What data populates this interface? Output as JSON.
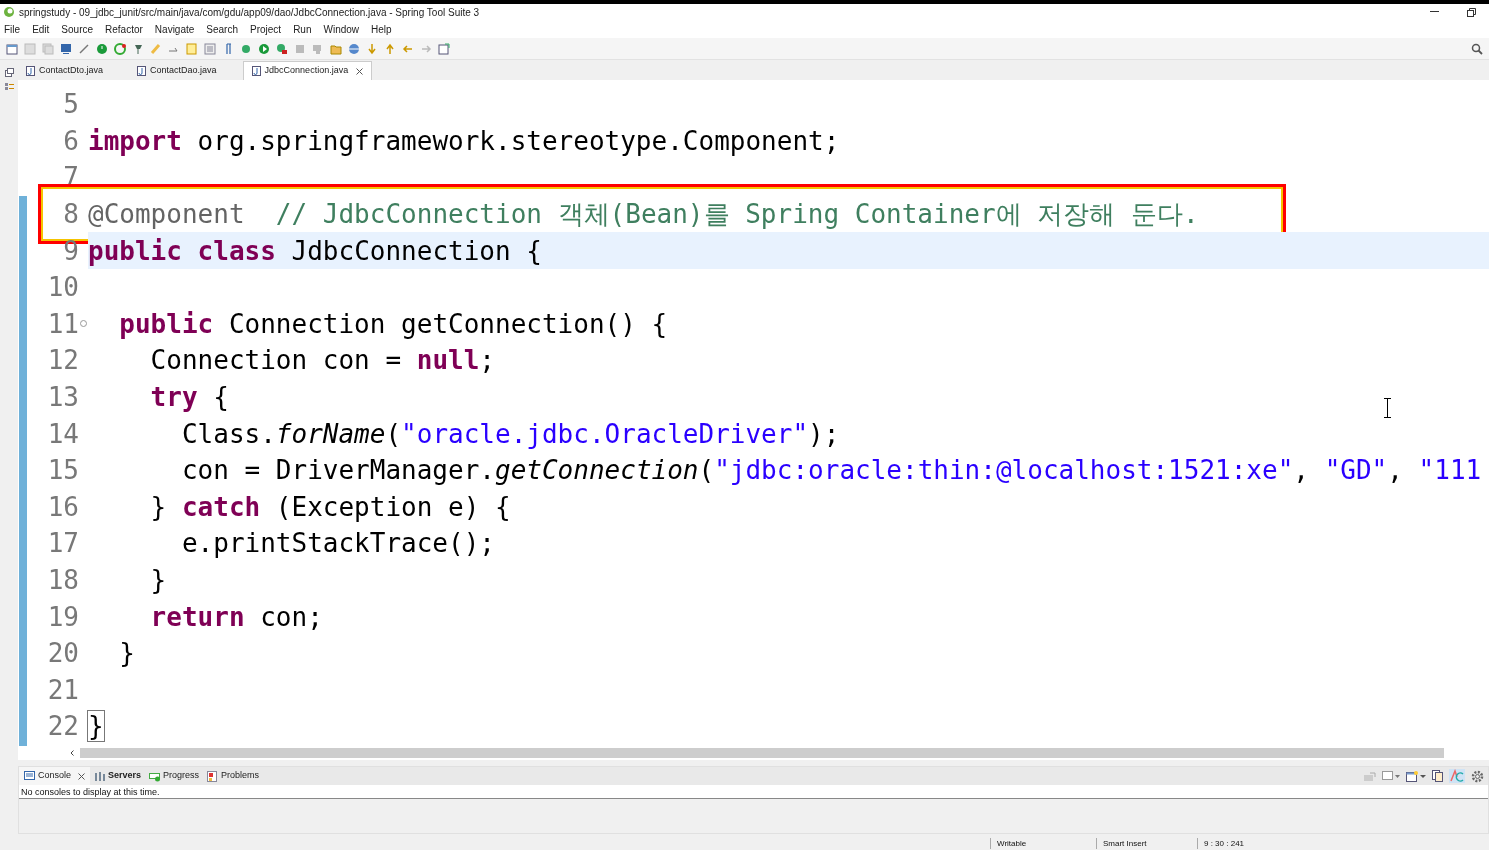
{
  "window": {
    "title": "springstudy - 09_jdbc_junit/src/main/java/com/gdu/app09/dao/JdbcConnection.java - Spring Tool Suite 3"
  },
  "menu": [
    "File",
    "Edit",
    "Source",
    "Refactor",
    "Navigate",
    "Search",
    "Project",
    "Run",
    "Window",
    "Help"
  ],
  "editor_tabs": [
    {
      "label": "ContactDto.java",
      "selected": false,
      "closable": false
    },
    {
      "label": "ContactDao.java",
      "selected": false,
      "closable": false
    },
    {
      "label": "JdbcConnection.java",
      "selected": true,
      "closable": true
    }
  ],
  "code_lines": [
    {
      "number": "5"
    },
    {
      "number": "6",
      "tokens": [
        {
          "text": "import",
          "kind": "keyword"
        },
        {
          "text": " org.springframework.stereotype.Component;",
          "kind": "plain"
        }
      ]
    },
    {
      "number": "7"
    },
    {
      "number": "8",
      "annotated": true,
      "tokens": [
        {
          "text": "@Component  ",
          "kind": "annotation"
        },
        {
          "text": "// JdbcConnection 객체(Bean)를 Spring Container에 저장해 둔다.",
          "kind": "comment"
        }
      ]
    },
    {
      "number": "9",
      "current": true,
      "tokens": [
        {
          "text": "public ",
          "kind": "keyword"
        },
        {
          "text": "class",
          "kind": "keyword"
        },
        {
          "text": " JdbcConnection {",
          "kind": "plain"
        }
      ]
    },
    {
      "number": "10"
    },
    {
      "number": "11",
      "foldable": true,
      "tokens": [
        {
          "text": "  public",
          "kind": "keyword"
        },
        {
          "text": " Connection getConnection() {",
          "kind": "plain"
        }
      ]
    },
    {
      "number": "12",
      "tokens": [
        {
          "text": "    Connection con = ",
          "kind": "plain"
        },
        {
          "text": "null",
          "kind": "keyword"
        },
        {
          "text": ";",
          "kind": "plain"
        }
      ]
    },
    {
      "number": "13",
      "tokens": [
        {
          "text": "    try",
          "kind": "keyword"
        },
        {
          "text": " {",
          "kind": "plain"
        }
      ]
    },
    {
      "number": "14",
      "tokens": [
        {
          "text": "      Class.",
          "kind": "plain"
        },
        {
          "text": "forName",
          "kind": "static"
        },
        {
          "text": "(",
          "kind": "plain"
        },
        {
          "text": "\"oracle.jdbc.OracleDriver\"",
          "kind": "string"
        },
        {
          "text": ");",
          "kind": "plain"
        }
      ]
    },
    {
      "number": "15",
      "tokens": [
        {
          "text": "      con = DriverManager.",
          "kind": "plain"
        },
        {
          "text": "getConnection",
          "kind": "static"
        },
        {
          "text": "(",
          "kind": "plain"
        },
        {
          "text": "\"jdbc:oracle:thin:@localhost:1521:xe\"",
          "kind": "string"
        },
        {
          "text": ", ",
          "kind": "plain"
        },
        {
          "text": "\"GD\"",
          "kind": "string"
        },
        {
          "text": ", ",
          "kind": "plain"
        },
        {
          "text": "\"111",
          "kind": "string"
        }
      ]
    },
    {
      "number": "16",
      "tokens": [
        {
          "text": "    } ",
          "kind": "plain"
        },
        {
          "text": "catch",
          "kind": "keyword"
        },
        {
          "text": " (Exception e) {",
          "kind": "plain"
        }
      ]
    },
    {
      "number": "17",
      "tokens": [
        {
          "text": "      e.printStackTrace();",
          "kind": "plain"
        }
      ]
    },
    {
      "number": "18",
      "tokens": [
        {
          "text": "    }",
          "kind": "plain"
        }
      ]
    },
    {
      "number": "19",
      "tokens": [
        {
          "text": "    return",
          "kind": "keyword"
        },
        {
          "text": " con;",
          "kind": "plain"
        }
      ]
    },
    {
      "number": "20",
      "tokens": [
        {
          "text": "  }",
          "kind": "plain"
        }
      ]
    },
    {
      "number": "21"
    },
    {
      "number": "22",
      "bracket_match": true,
      "tokens": [
        {
          "text": "}",
          "kind": "plain"
        }
      ]
    }
  ],
  "panel_tabs": [
    {
      "label": "Console",
      "selected": true,
      "closable": true,
      "bold": false
    },
    {
      "label": "Servers",
      "selected": false,
      "closable": false,
      "bold": true
    },
    {
      "label": "Progress",
      "selected": false,
      "closable": false,
      "bold": false
    },
    {
      "label": "Problems",
      "selected": false,
      "closable": false,
      "bold": false
    }
  ],
  "console_message": "No consoles to display at this time.",
  "status_bar": [
    "Writable",
    "Smart Insert",
    "9 : 30 : 241"
  ]
}
